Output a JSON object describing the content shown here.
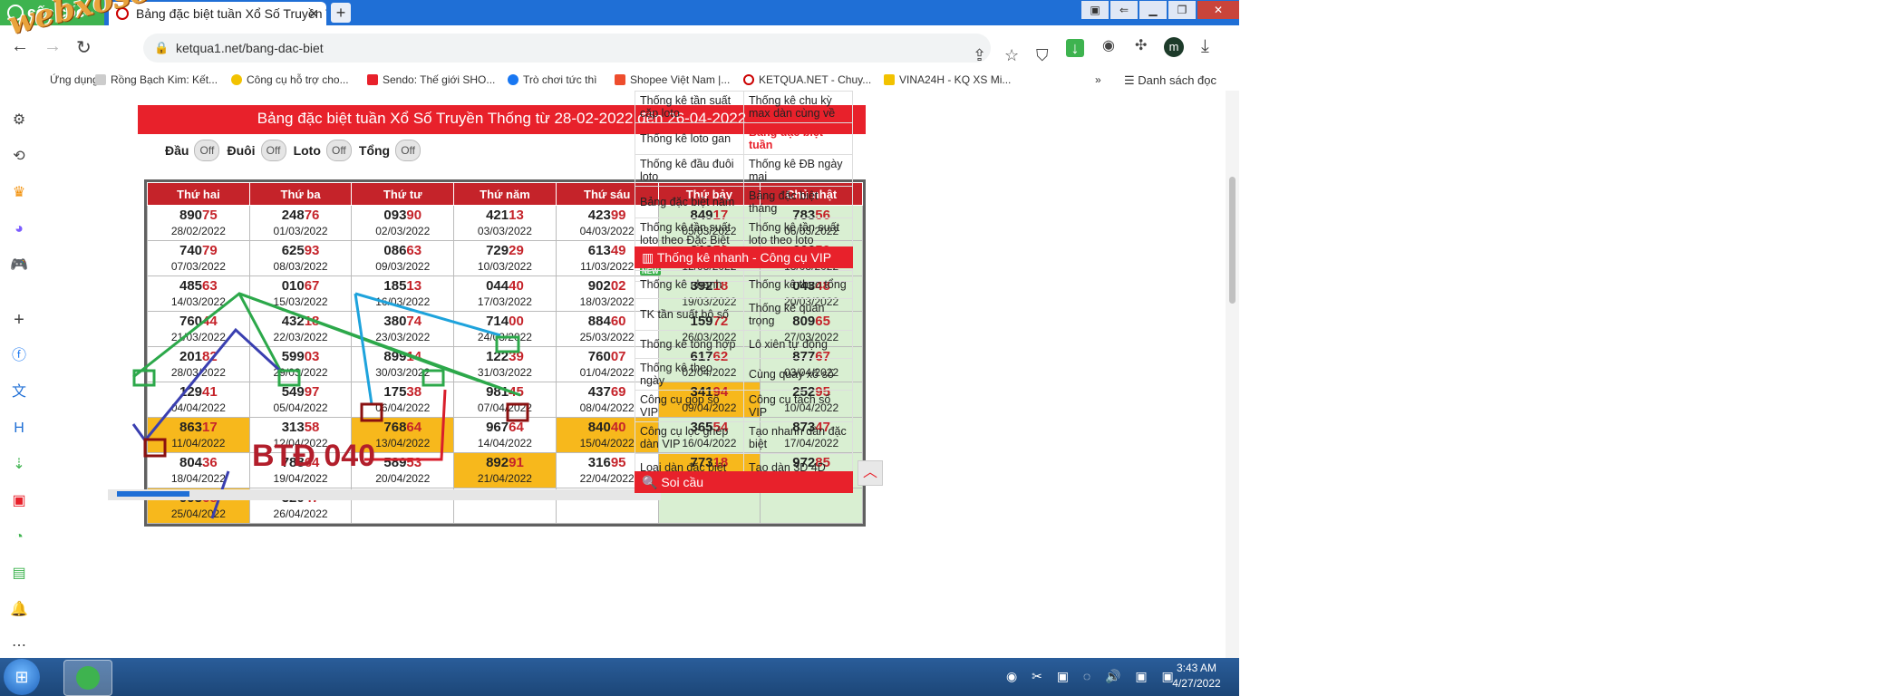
{
  "browser": {
    "brand": "cốc cốc",
    "tab_title": "Bảng đặc biệt tuần Xổ Số Truyền Thống",
    "tab_close": "✕",
    "new_tab": "+",
    "url": "ketqua1.net/bang-dac-biet",
    "profile_initial": "m",
    "reading_list": "Danh sách đọc",
    "more_bookmarks": "»"
  },
  "watermark": "webxoso.net",
  "bookmarks": [
    {
      "label": "Ứng dụng"
    },
    {
      "label": "Rồng Bạch Kim: Kết..."
    },
    {
      "label": "Công cụ hỗ trợ cho..."
    },
    {
      "label": "Sendo: Thế giới SHO..."
    },
    {
      "label": "Trò chơi tức thì"
    },
    {
      "label": "Shopee Việt Nam |..."
    },
    {
      "label": "KETQUA.NET - Chuy..."
    },
    {
      "label": "VINA24H - KQ XS Mi..."
    }
  ],
  "page": {
    "title": "Bảng đặc biệt tuần Xổ Số Truyền Thống từ 28-02-2022 đến 26-04-2022",
    "filters": [
      {
        "label": "Đầu",
        "state": "Off"
      },
      {
        "label": "Đuôi",
        "state": "Off"
      },
      {
        "label": "Loto",
        "state": "Off"
      },
      {
        "label": "Tổng",
        "state": "Off"
      }
    ],
    "weekdays": [
      "Thứ hai",
      "Thứ ba",
      "Thứ tư",
      "Thứ năm",
      "Thứ sáu",
      "Thứ bảy",
      "Chủ nhật"
    ],
    "rows": [
      [
        {
          "head": "890",
          "tail": "75",
          "date": "28/02/2022"
        },
        {
          "head": "248",
          "tail": "76",
          "date": "01/03/2022"
        },
        {
          "head": "093",
          "tail": "90",
          "date": "02/03/2022"
        },
        {
          "head": "421",
          "tail": "13",
          "date": "03/03/2022"
        },
        {
          "head": "423",
          "tail": "99",
          "date": "04/03/2022"
        },
        {
          "head": "849",
          "tail": "17",
          "date": "05/03/2022"
        },
        {
          "head": "783",
          "tail": "56",
          "date": "06/03/2022"
        }
      ],
      [
        {
          "head": "740",
          "tail": "79",
          "date": "07/03/2022"
        },
        {
          "head": "625",
          "tail": "93",
          "date": "08/03/2022"
        },
        {
          "head": "086",
          "tail": "63",
          "date": "09/03/2022"
        },
        {
          "head": "729",
          "tail": "29",
          "date": "10/03/2022"
        },
        {
          "head": "613",
          "tail": "49",
          "date": "11/03/2022"
        },
        {
          "head": "319",
          "tail": "53",
          "date": "12/03/2022"
        },
        {
          "head": "666",
          "tail": "50",
          "date": "13/03/2022"
        }
      ],
      [
        {
          "head": "485",
          "tail": "63",
          "date": "14/03/2022"
        },
        {
          "head": "010",
          "tail": "67",
          "date": "15/03/2022"
        },
        {
          "head": "185",
          "tail": "13",
          "date": "16/03/2022"
        },
        {
          "head": "044",
          "tail": "40",
          "date": "17/03/2022"
        },
        {
          "head": "902",
          "tail": "02",
          "date": "18/03/2022"
        },
        {
          "head": "392",
          "tail": "18",
          "date": "19/03/2022"
        },
        {
          "head": "043",
          "tail": "48",
          "date": "20/03/2022"
        }
      ],
      [
        {
          "head": "760",
          "tail": "44",
          "date": "21/03/2022"
        },
        {
          "head": "432",
          "tail": "18",
          "date": "22/03/2022"
        },
        {
          "head": "380",
          "tail": "74",
          "date": "23/03/2022"
        },
        {
          "head": "714",
          "tail": "00",
          "date": "24/03/2022"
        },
        {
          "head": "884",
          "tail": "60",
          "date": "25/03/2022"
        },
        {
          "head": "159",
          "tail": "72",
          "date": "26/03/2022"
        },
        {
          "head": "809",
          "tail": "65",
          "date": "27/03/2022"
        }
      ],
      [
        {
          "head": "201",
          "tail": "82",
          "date": "28/03/2022"
        },
        {
          "head": "599",
          "tail": "03",
          "date": "29/03/2022"
        },
        {
          "head": "899",
          "tail": "14",
          "date": "30/03/2022"
        },
        {
          "head": "122",
          "tail": "39",
          "date": "31/03/2022"
        },
        {
          "head": "760",
          "tail": "07",
          "date": "01/04/2022"
        },
        {
          "head": "617",
          "tail": "62",
          "date": "02/04/2022"
        },
        {
          "head": "877",
          "tail": "67",
          "date": "03/04/2022"
        }
      ],
      [
        {
          "head": "129",
          "tail": "41",
          "date": "04/04/2022"
        },
        {
          "head": "549",
          "tail": "97",
          "date": "05/04/2022"
        },
        {
          "head": "175",
          "tail": "38",
          "date": "06/04/2022"
        },
        {
          "head": "981",
          "tail": "45",
          "date": "07/04/2022"
        },
        {
          "head": "437",
          "tail": "69",
          "date": "08/04/2022"
        },
        {
          "head": "341",
          "tail": "94",
          "date": "09/04/2022",
          "hl": true
        },
        {
          "head": "252",
          "tail": "95",
          "date": "10/04/2022"
        }
      ],
      [
        {
          "head": "863",
          "tail": "17",
          "date": "11/04/2022",
          "hl": true
        },
        {
          "head": "313",
          "tail": "58",
          "date": "12/04/2022"
        },
        {
          "head": "768",
          "tail": "64",
          "date": "13/04/2022",
          "hl": true
        },
        {
          "head": "967",
          "tail": "64",
          "date": "14/04/2022"
        },
        {
          "head": "840",
          "tail": "40",
          "date": "15/04/2022",
          "hl": true
        },
        {
          "head": "365",
          "tail": "54",
          "date": "16/04/2022"
        },
        {
          "head": "873",
          "tail": "47",
          "date": "17/04/2022"
        }
      ],
      [
        {
          "head": "804",
          "tail": "36",
          "date": "18/04/2022"
        },
        {
          "head": "788",
          "tail": "64",
          "date": "19/04/2022"
        },
        {
          "head": "589",
          "tail": "53",
          "date": "20/04/2022"
        },
        {
          "head": "892",
          "tail": "91",
          "date": "21/04/2022",
          "hl": true
        },
        {
          "head": "316",
          "tail": "95",
          "date": "22/04/2022"
        },
        {
          "head": "773",
          "tail": "18",
          "date": "23/04/2022",
          "hl": true
        },
        {
          "head": "972",
          "tail": "85",
          "date": "24/04/2022"
        }
      ],
      [
        {
          "head": "993",
          "tail": "68",
          "date": "25/04/2022",
          "hl": true
        },
        {
          "head": "320",
          "tail": "47",
          "date": "26/04/2022"
        },
        {
          "head": "",
          "tail": "",
          "date": ""
        },
        {
          "head": "",
          "tail": "",
          "date": ""
        },
        {
          "head": "",
          "tail": "",
          "date": ""
        },
        {
          "head": "",
          "tail": "",
          "date": ""
        },
        {
          "head": "",
          "tail": "",
          "date": ""
        }
      ]
    ],
    "annotation": "BTĐ 040"
  },
  "side_links": [
    [
      "Thống kê tần suất cặp loto",
      "Thống kê chu kỳ max dàn cùng về"
    ],
    [
      "Thống kê loto gan",
      "Bảng đặc biệt tuần"
    ],
    [
      "Thống kê đầu đuôi loto",
      "Thống kê ĐB ngày mai"
    ],
    [
      "Bảng đặc biệt năm",
      "Bảng đặc biệt tháng"
    ],
    [
      "Thống kê tần suất loto theo Đặc Biệt",
      "Thống kê tần suất loto theo loto"
    ],
    [
      "Thống kê giải nhất",
      ""
    ]
  ],
  "side_new_badge": "NEW",
  "vip": {
    "title": "Thống kê nhanh - Công cụ VIP",
    "links": [
      [
        "Thống kê nhanh",
        "Thống kê theo tổng"
      ],
      [
        "TK tần suất bộ số",
        "Thống kê quan trọng"
      ],
      [
        "Thống kê tổng hợp",
        "Lô xiên tự động"
      ],
      [
        "Thống kê theo ngày",
        "Cùng quay xổ số"
      ],
      [
        "Công cụ gộp số VIP",
        "Công cụ tách số VIP"
      ],
      [
        "Công cụ lọc ghép dàn VIP",
        "Tạo nhanh dàn đặc biệt"
      ],
      [
        "Loại dàn đặc biệt",
        "Tạo dàn 3D 4D"
      ]
    ]
  },
  "soi_cau_title": "Soi cầu",
  "taskbar": {
    "time": "3:43 AM",
    "date": "4/27/2022"
  },
  "colors": {
    "accent_red": "#e8212b",
    "weekend_bg": "#d9efd2",
    "highlight_bg": "#f7b81c",
    "brand_green": "#3eb34f",
    "tabbar_blue": "#1f6fd6"
  }
}
